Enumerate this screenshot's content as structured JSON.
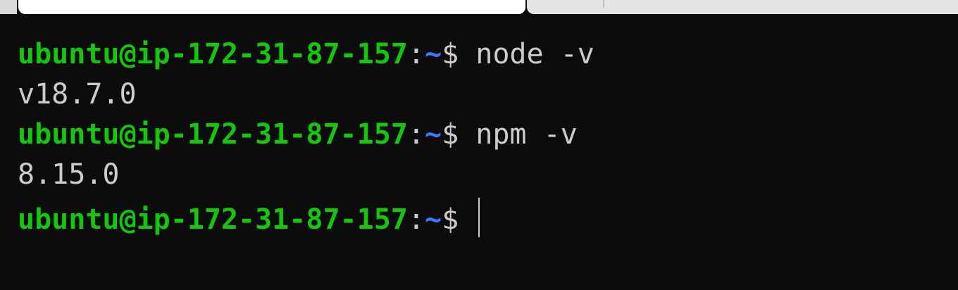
{
  "terminal": {
    "lines": [
      {
        "type": "prompt",
        "user_host": "ubuntu@ip-172-31-87-157",
        "colon": ":",
        "path": "~",
        "dollar": "$",
        "command": " node -v"
      },
      {
        "type": "output",
        "text": "v18.7.0"
      },
      {
        "type": "prompt",
        "user_host": "ubuntu@ip-172-31-87-157",
        "colon": ":",
        "path": "~",
        "dollar": "$",
        "command": " npm -v"
      },
      {
        "type": "output",
        "text": "8.15.0"
      },
      {
        "type": "prompt",
        "user_host": "ubuntu@ip-172-31-87-157",
        "colon": ":",
        "path": "~",
        "dollar": "$",
        "command": " "
      }
    ]
  },
  "colors": {
    "background": "#0c0c0c",
    "user_host": "#16c60c",
    "path": "#3b78ff",
    "text": "#cccccc"
  }
}
